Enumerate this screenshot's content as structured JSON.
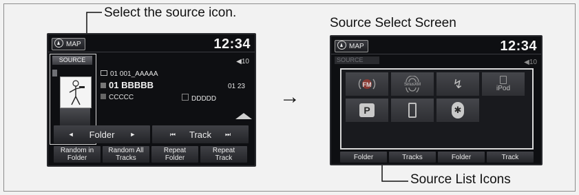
{
  "annotations": {
    "select_source_icon": "Select the source icon.",
    "source_select_screen": "Source Select Screen",
    "source_list_icons": "Source List Icons",
    "arrow_glyph": "→"
  },
  "left_screen": {
    "map_label": "MAP",
    "clock": "12:34",
    "source_label": "SOURCE",
    "volume": "◀10",
    "folder_line": "01 001_AAAAA",
    "track_title": "01 BBBBB",
    "track_time": "01 23",
    "artist": "CCCCC",
    "album": "DDDDD",
    "folder_button": "Folder",
    "track_button": "Track",
    "prev_glyph": "◄",
    "next_glyph": "►",
    "skip_back_glyph": "⏮",
    "skip_fwd_glyph": "⏭",
    "bottom_buttons": [
      {
        "line1": "Random in",
        "line2": "Folder"
      },
      {
        "line1": "Random All",
        "line2": "Tracks"
      },
      {
        "line1": "Repeat",
        "line2": "Folder"
      },
      {
        "line1": "Repeat",
        "line2": "Track"
      }
    ]
  },
  "right_screen": {
    "map_label": "MAP",
    "clock": "12:34",
    "source_label": "SOURCE",
    "volume": "◀10",
    "sources": [
      {
        "name": "fm-radio",
        "label": "FM"
      },
      {
        "name": "siriusxm",
        "label": "SiriusXM"
      },
      {
        "name": "usb",
        "label": "↯"
      },
      {
        "name": "ipod",
        "label": "iPod"
      },
      {
        "name": "pandora",
        "label": "P"
      },
      {
        "name": "smartphone",
        "label": ""
      },
      {
        "name": "bluetooth",
        "label": "✱"
      }
    ],
    "bottom_buttons": [
      "Folder",
      "Tracks",
      "Folder",
      "Track"
    ]
  }
}
